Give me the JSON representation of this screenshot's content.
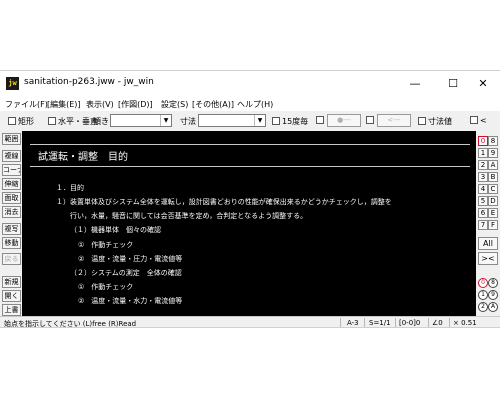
{
  "window": {
    "app_icon": "jw",
    "title": "sanitation-p263.jww - jw_win",
    "minimize": "—",
    "maximize": "☐",
    "close": "✕"
  },
  "menu": [
    "ファイル(F)",
    "[編集(E)]",
    "表示(V)",
    "[作図(D)]",
    "設定(S)",
    "[その他(A)]",
    "ヘルプ(H)"
  ],
  "toolbar": {
    "rect": "矩形",
    "hv": "水平・垂直",
    "slope": "傾き",
    "dim": "寸法",
    "deg15": "15度毎",
    "btn1": "●---",
    "btn2": "<---",
    "dimval": "寸法値",
    "lt": "<"
  },
  "left_tools": [
    "範囲",
    "複線",
    "コーナー",
    "伸縮",
    "面取",
    "消去",
    "複写",
    "移動",
    "戻る",
    "新規",
    "開く",
    "上書"
  ],
  "document": {
    "heading": "試運転・調整　目的",
    "lines": [
      "１．目的",
      "１）装置単体及びシステム全体を運転し，設計図書どおりの性能が確保出来るかどうかチェックし，調整を",
      "行い，水量，騒音に関しては会否基準を定め，合判定となるよう調整する。",
      "（１）機器単体　個々の確認",
      "①　作動チェック",
      "②　温度・流量・圧力・電流値等",
      "（２）システムの測定　全体の確認",
      "①　作動チェック",
      "②　温度・流量・水力・電流値等"
    ]
  },
  "right_tools": {
    "layer_pairs": [
      [
        "0",
        "8"
      ],
      [
        "1",
        "9"
      ],
      [
        "2",
        "A"
      ],
      [
        "3",
        "B"
      ],
      [
        "4",
        "C"
      ],
      [
        "5",
        "D"
      ],
      [
        "6",
        "E"
      ],
      [
        "7",
        "F"
      ]
    ],
    "all": "All",
    "cross": "><",
    "circles": [
      [
        "0",
        "8"
      ],
      [
        "1",
        "9"
      ],
      [
        "2",
        "A"
      ]
    ]
  },
  "status": {
    "message": "始点を指示してください (L)free (R)Read",
    "paper": "A-3",
    "scale": "S=1/1",
    "layer": "[0-0]0",
    "angle": "∠0",
    "zoom": "× 0.51"
  }
}
